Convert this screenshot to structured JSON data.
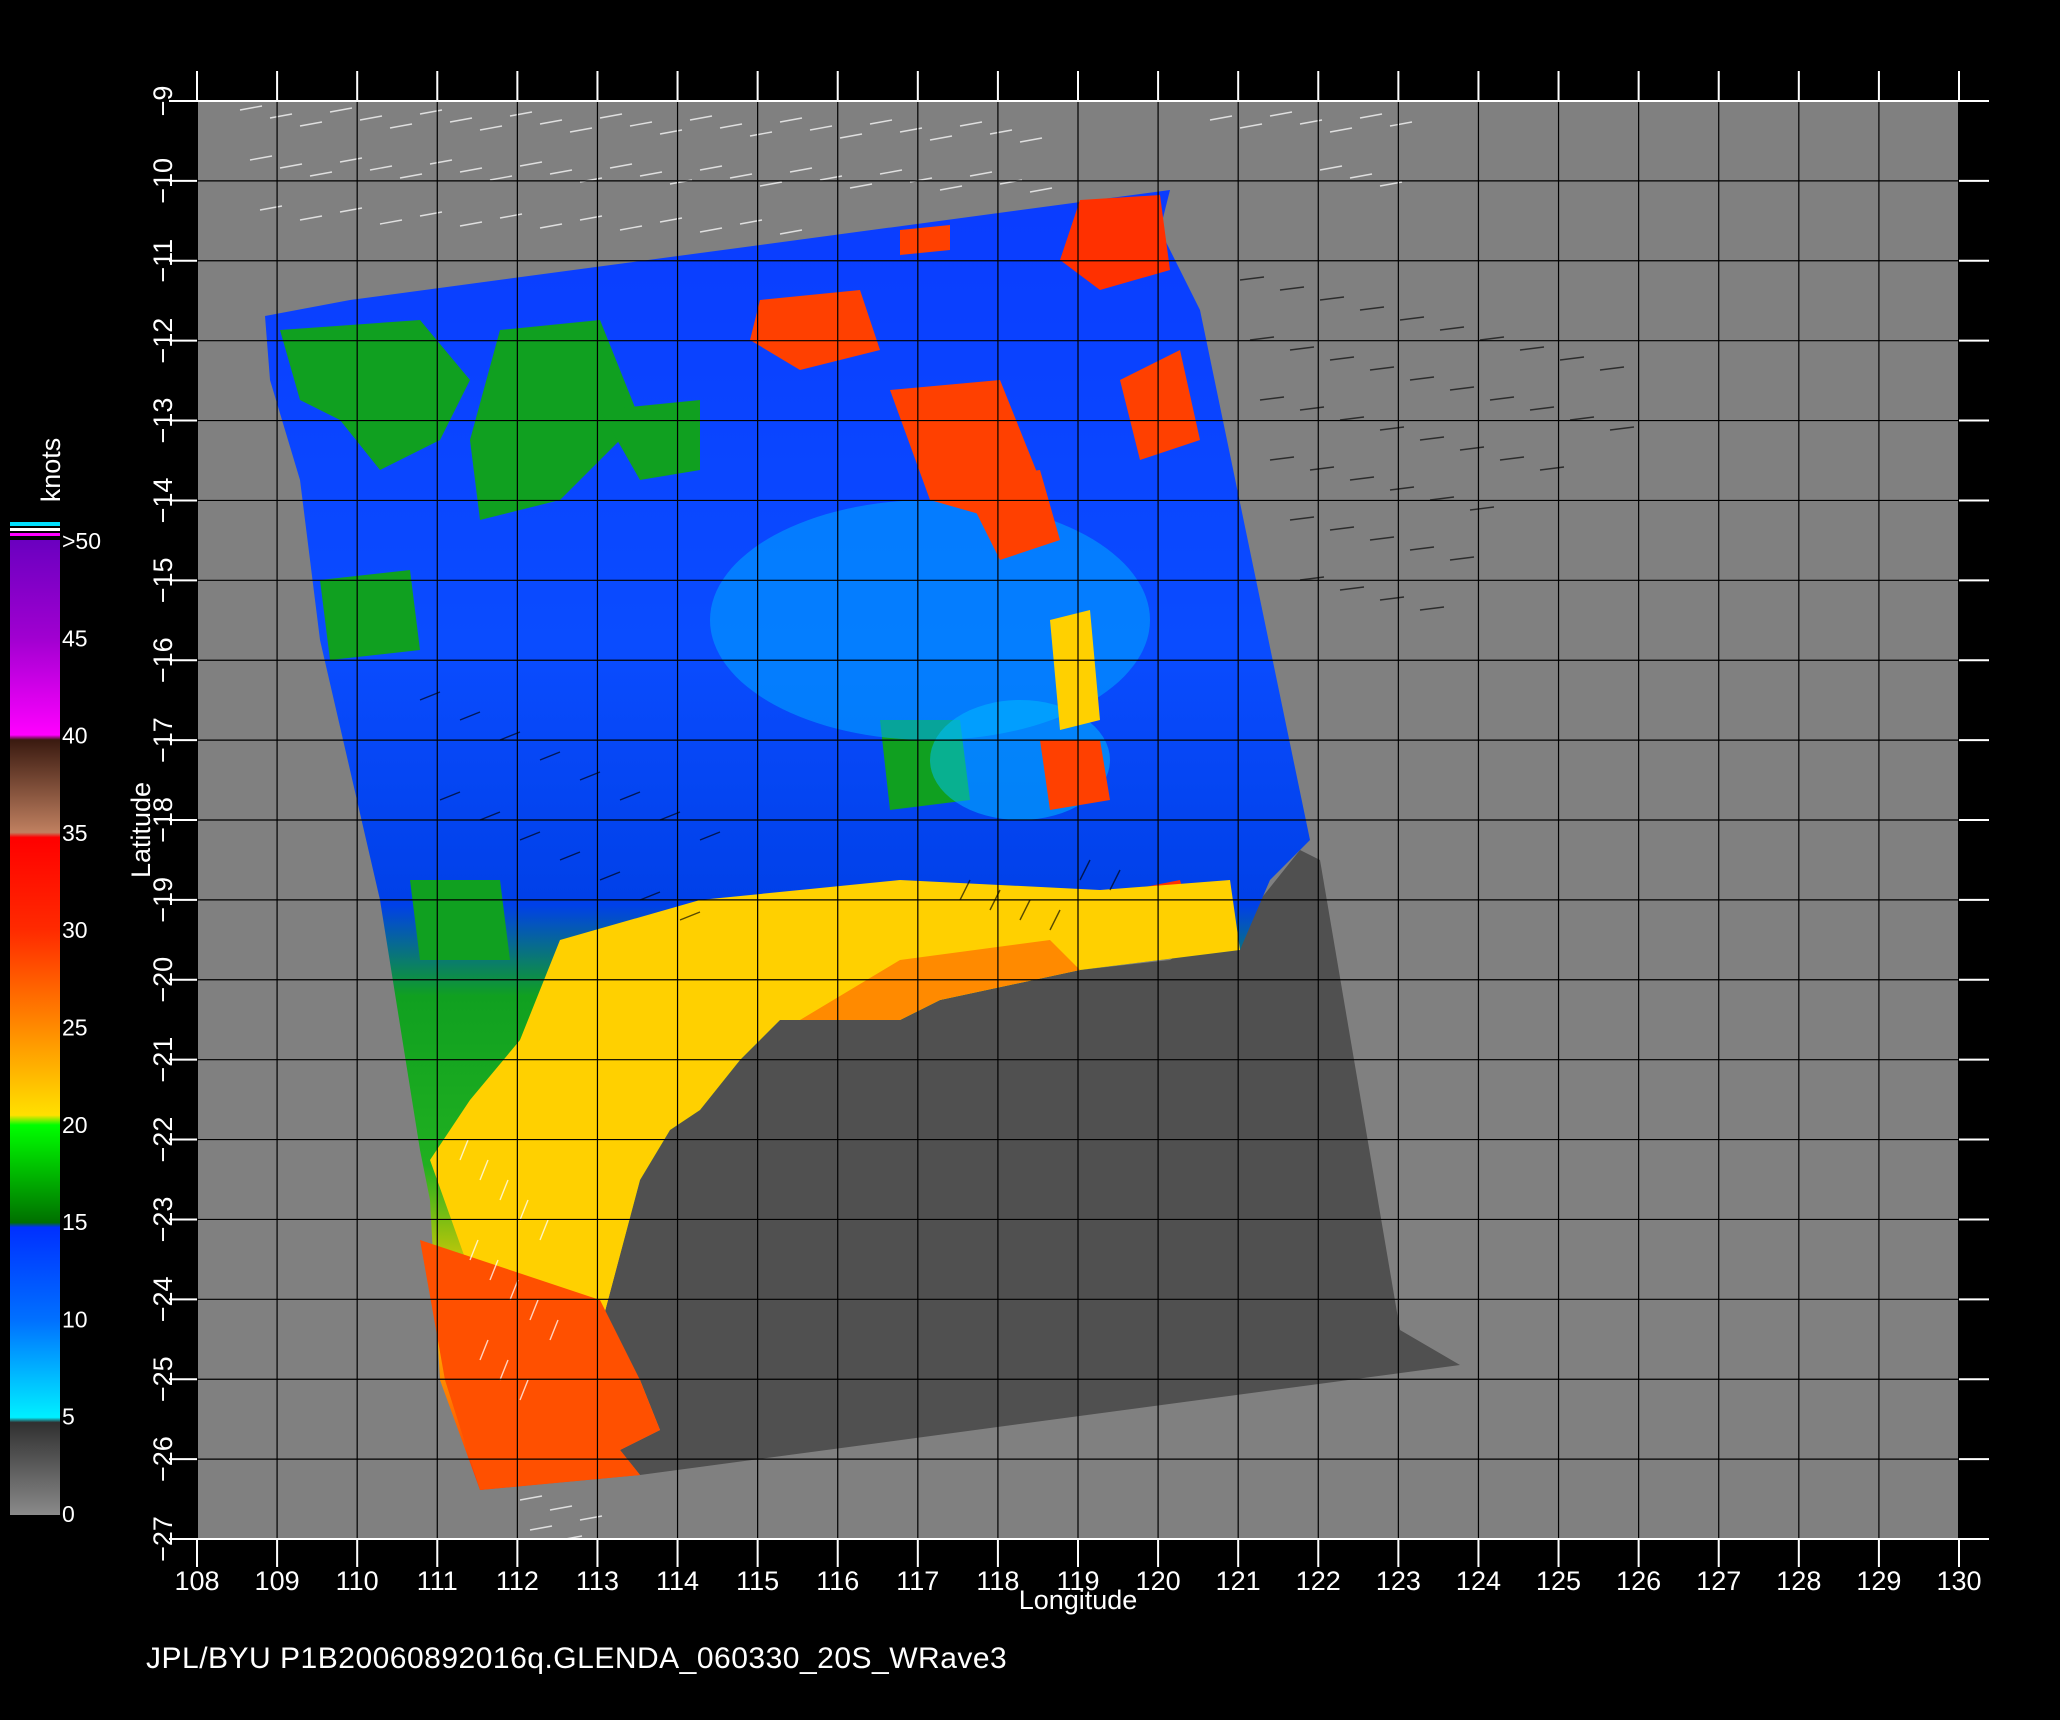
{
  "map": {
    "xlabel": "Longitude",
    "ylabel": "Latitude",
    "lon_range": [
      108,
      130
    ],
    "lat_range": [
      -9,
      -27
    ],
    "lon_ticks": [
      "108",
      "109",
      "110",
      "111",
      "112",
      "113",
      "114",
      "115",
      "116",
      "117",
      "118",
      "119",
      "120",
      "121",
      "122",
      "123",
      "124",
      "125",
      "126",
      "127",
      "128",
      "129",
      "130"
    ],
    "lat_ticks": [
      "-9",
      "-10",
      "-11",
      "-12",
      "-13",
      "-14",
      "-15",
      "-16",
      "-17",
      "-18",
      "-19",
      "-20",
      "-21",
      "-22",
      "-23",
      "-24",
      "-25",
      "-26",
      "-27"
    ],
    "background_color": "#808080",
    "land_color": "#505050",
    "grid": true
  },
  "colorbar": {
    "unit": "knots",
    "labels": [
      ">50",
      "45",
      "40",
      "35",
      "30",
      "25",
      "20",
      "15",
      "10",
      "5",
      "0"
    ],
    "colors": {
      "0-5": "#6e6e6e",
      "5-10": "#00b4ff",
      "10-15": "#0050ff",
      "15-20": "#00a000",
      "20-25": "#ffe000",
      "25-30": "#ff6a00",
      "30-35": "#ff2000",
      "35-40": "#8a4a2a",
      "40-45": "#ff00ff",
      "45-50": "#a000d0"
    }
  },
  "footer": {
    "text": "JPL/BYU  P1B20060892016q.GLENDA_060330_20S_WRave3"
  }
}
